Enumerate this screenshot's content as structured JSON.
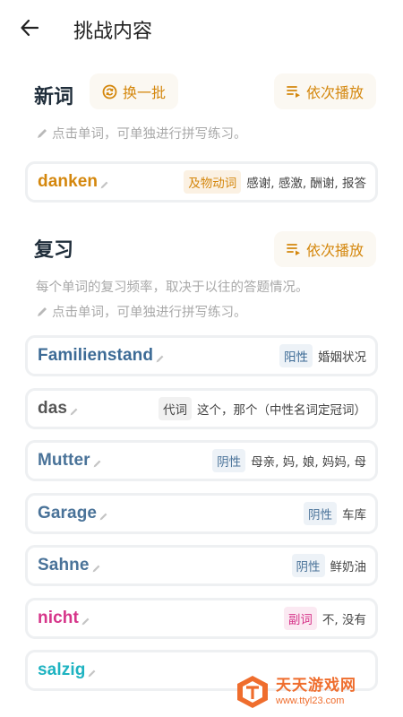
{
  "header": {
    "title": "挑战内容"
  },
  "new_words": {
    "title": "新词",
    "refresh_label": "换一批",
    "play_label": "依次播放",
    "hint": "点击单词，可单独进行拼写练习。",
    "items": [
      {
        "word": "danken",
        "tag": "及物动词",
        "meaning": "感谢, 感激, 酬谢, 报答",
        "color": "#d4870d",
        "tag_bg": "#fbf1e3",
        "tag_color": "#d4870d"
      }
    ]
  },
  "review": {
    "title": "复习",
    "play_label": "依次播放",
    "description": "每个单词的复习频率，取决于以往的答题情况。",
    "hint": "点击单词，可单独进行拼写练习。",
    "items": [
      {
        "word": "Familienstand",
        "tag": "阳性",
        "meaning": "婚姻状况",
        "color": "#3d6b96",
        "tag_bg": "#edf2f7",
        "tag_color": "#3d6b96"
      },
      {
        "word": "das",
        "tag": "代词",
        "meaning": "这个，那个（中性名词定冠词）",
        "color": "#555555",
        "tag_bg": "#f1f1f1",
        "tag_color": "#444444"
      },
      {
        "word": "Mutter",
        "tag": "阴性",
        "meaning": "母亲, 妈, 娘, 妈妈, 母",
        "color": "#4a7399",
        "tag_bg": "#edf2f7",
        "tag_color": "#4a7399"
      },
      {
        "word": "Garage",
        "tag": "阴性",
        "meaning": "车库",
        "color": "#4a7399",
        "tag_bg": "#edf2f7",
        "tag_color": "#4a7399"
      },
      {
        "word": "Sahne",
        "tag": "阴性",
        "meaning": "鲜奶油",
        "color": "#4a7399",
        "tag_bg": "#edf2f7",
        "tag_color": "#4a7399"
      },
      {
        "word": "nicht",
        "tag": "副词",
        "meaning": "不, 没有",
        "color": "#d6358a",
        "tag_bg": "#fbe9f2",
        "tag_color": "#d6358a"
      },
      {
        "word": "salzig",
        "tag": "",
        "meaning": "",
        "color": "#1eb3c1",
        "tag_bg": "#e6f7f8",
        "tag_color": "#1eb3c1"
      }
    ]
  },
  "watermark": {
    "name": "天天游戏网",
    "url": "www.ttyl23.com"
  }
}
